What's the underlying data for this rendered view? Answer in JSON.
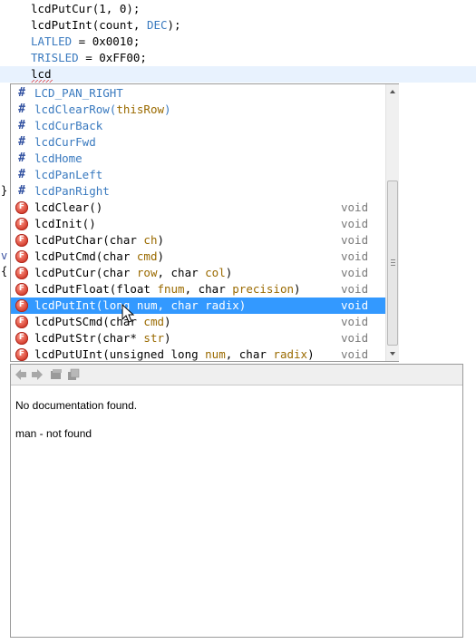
{
  "editor": {
    "lines": [
      {
        "plain": "lcdPutCur(1, 0);"
      },
      {
        "before": "lcdPutInt(count, ",
        "macro": "DEC",
        "after": ");"
      },
      {
        "macro": "LATLED",
        "after": " = 0x0010;"
      },
      {
        "macro": "TRISLED",
        "after": " = 0xFF00;"
      },
      {
        "plain": "lcd"
      }
    ],
    "gutter_fragments": [
      "}",
      "v",
      "{"
    ]
  },
  "completion": {
    "items": [
      {
        "kind": "macro",
        "name": "LCD_PAN_RIGHT"
      },
      {
        "kind": "macro",
        "name": "lcdClearRow(",
        "param": "thisRow",
        "close": ")"
      },
      {
        "kind": "macro",
        "name": "lcdCurBack"
      },
      {
        "kind": "macro",
        "name": "lcdCurFwd"
      },
      {
        "kind": "macro",
        "name": "lcdHome"
      },
      {
        "kind": "macro",
        "name": "lcdPanLeft"
      },
      {
        "kind": "macro",
        "name": "lcdPanRight"
      },
      {
        "kind": "function",
        "sig": "lcdClear()",
        "ret": "void"
      },
      {
        "kind": "function",
        "sig": "lcdInit()",
        "ret": "void"
      },
      {
        "kind": "function",
        "pre": "lcdPutChar(char ",
        "p1": "ch",
        "post": ")",
        "ret": "void"
      },
      {
        "kind": "function",
        "pre": "lcdPutCmd(char ",
        "p1": "cmd",
        "post": ")",
        "ret": "void"
      },
      {
        "kind": "function",
        "pre": "lcdPutCur(char ",
        "p1": "row",
        "mid": ", char ",
        "p2": "col",
        "post": ")",
        "ret": "void"
      },
      {
        "kind": "function",
        "pre": "lcdPutFloat(float ",
        "p1": "fnum",
        "mid": ", char ",
        "p2": "precision",
        "post": ")",
        "ret": "void"
      },
      {
        "kind": "function",
        "pre": "lcdPutInt(long ",
        "p1": "num",
        "mid": ", char ",
        "p2": "radix",
        "post": ")",
        "ret": "void",
        "selected": true
      },
      {
        "kind": "function",
        "pre": "lcdPutSCmd(char ",
        "p1": "cmd",
        "post": ")",
        "ret": "void"
      },
      {
        "kind": "function",
        "pre": "lcdPutStr(char* ",
        "p1": "str",
        "post": ")",
        "ret": "void"
      },
      {
        "kind": "function",
        "pre": "lcdPutUInt(unsigned long ",
        "p1": "num",
        "mid": ", char ",
        "p2": "radix",
        "post": ")",
        "ret": "void"
      }
    ],
    "macro_icon_glyph": "#",
    "function_icon_glyph": "F"
  },
  "documentation": {
    "toolbar": [
      "back-arrow-icon",
      "forward-arrow-icon",
      "open-source-icon",
      "open-browser-icon"
    ],
    "message": "No documentation found.",
    "detail": "man - not found"
  },
  "colors": {
    "macro": "#3a7abf",
    "parameter": "#9a6a00",
    "selection": "#3399ff",
    "return_type": "#7a7a7a"
  }
}
